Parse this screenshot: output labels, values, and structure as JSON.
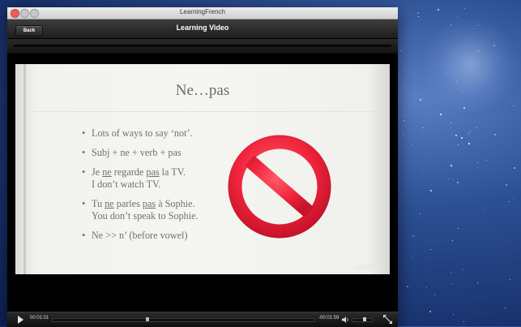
{
  "window": {
    "title": "LearningFrench"
  },
  "nav": {
    "back_label": "Back",
    "title": "Learning Video"
  },
  "slide": {
    "title": "Ne…pas",
    "bullets": [
      {
        "parts": [
          {
            "text": "Lots of ways to say ‘not’."
          }
        ]
      },
      {
        "parts": [
          {
            "text": "Subj + ne + verb + pas"
          }
        ]
      },
      {
        "parts": [
          {
            "text": "Je "
          },
          {
            "text": "ne",
            "u": true
          },
          {
            "text": " regarde "
          },
          {
            "text": "pas",
            "u": true
          },
          {
            "text": " la TV."
          }
        ],
        "line2": "I don’t watch TV."
      },
      {
        "parts": [
          {
            "text": "Tu "
          },
          {
            "text": "ne",
            "u": true
          },
          {
            "text": " parles "
          },
          {
            "text": "pas",
            "u": true
          },
          {
            "text": " à Sophie."
          }
        ],
        "line2": "You don’t speak to Sophie."
      },
      {
        "parts": [
          {
            "text": "Ne >> n’ (before vowel)"
          }
        ]
      }
    ],
    "watermark": "udemy"
  },
  "player": {
    "elapsed": "00:01:01",
    "remaining": "-00:01:59",
    "progress_fraction": 0.36,
    "volume_fraction": 0.6
  },
  "colors": {
    "no_sign": "#f0243c",
    "slide_text": "#707070"
  },
  "icons": [
    "play-icon",
    "volume-icon",
    "fullscreen-icon",
    "no-sign-icon"
  ]
}
